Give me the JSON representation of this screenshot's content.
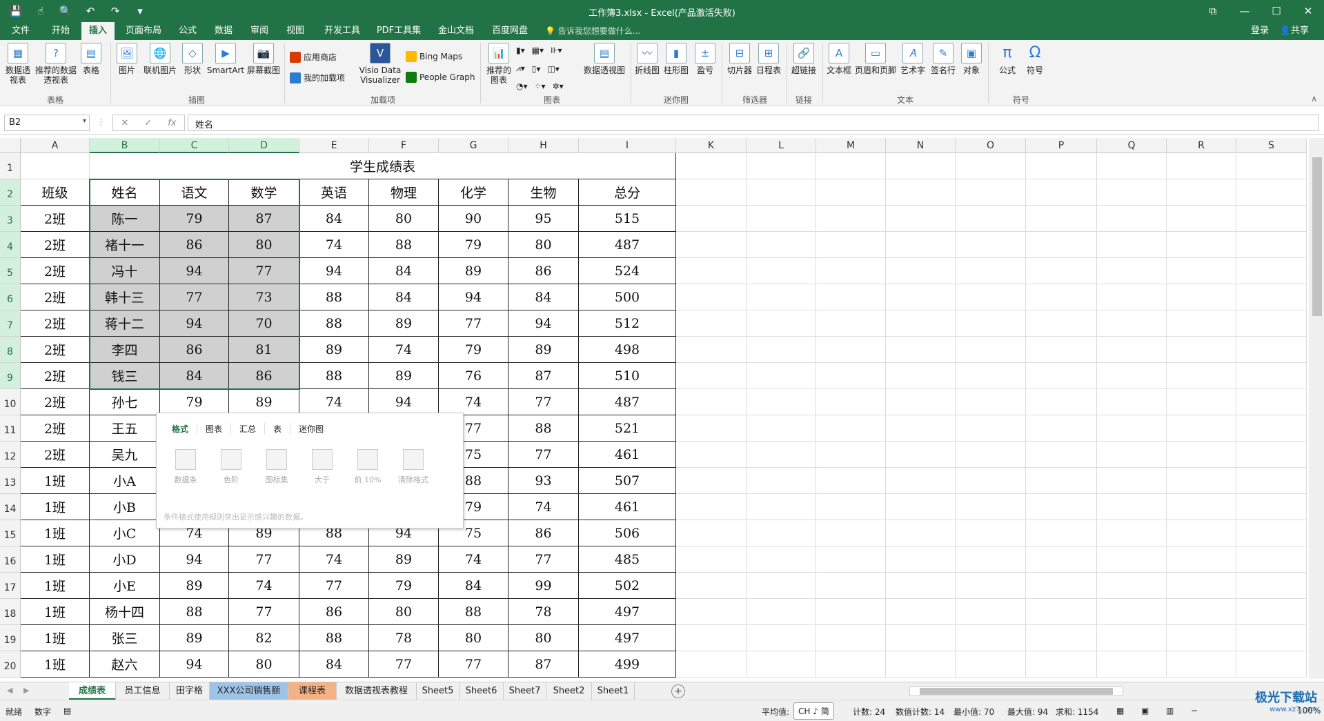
{
  "title_bar": {
    "title": "工作簿3.xlsx - Excel(产品激活失败)",
    "controls": [
      "⧉",
      "—",
      "☐",
      "✕"
    ]
  },
  "quick_access": {
    "icons": [
      "save-icon",
      "touch-icon",
      "preview-icon",
      "undo-icon",
      "redo-icon",
      "customize-icon"
    ]
  },
  "menu_tabs": [
    {
      "label": "文件"
    },
    {
      "label": "开始"
    },
    {
      "label": "插入"
    },
    {
      "label": "页面布局"
    },
    {
      "label": "公式"
    },
    {
      "label": "数据"
    },
    {
      "label": "审阅"
    },
    {
      "label": "视图"
    },
    {
      "label": "开发工具"
    },
    {
      "label": "PDF工具集"
    },
    {
      "label": "金山文档"
    },
    {
      "label": "百度网盘"
    }
  ],
  "active_tab": "插入",
  "tell_me": "告诉我您想要做什么...",
  "account": {
    "login": "登录",
    "share": "共享"
  },
  "ribbon": {
    "tables_group": {
      "label": "表格",
      "buttons": [
        "数据透视表",
        "推荐的数据透视表",
        "表格"
      ]
    },
    "illustrations_group": {
      "label": "插图",
      "buttons": [
        "图片",
        "联机图片",
        "形状",
        "SmartArt",
        "屏幕截图"
      ]
    },
    "addins_group": {
      "label": "加载项",
      "buttons": [
        "应用商店",
        "我的加载项",
        "Visio Data Visualizer",
        "Bing Maps",
        "People Graph"
      ]
    },
    "charts_group": {
      "label": "图表",
      "buttons": [
        "推荐的图表",
        "数据透视图"
      ]
    },
    "sparklines_group": {
      "label": "迷你图",
      "buttons": [
        "折线图",
        "柱形图",
        "盈亏"
      ]
    },
    "filters_group": {
      "label": "筛选器",
      "buttons": [
        "切片器",
        "日程表"
      ]
    },
    "links_group": {
      "label": "链接",
      "buttons": [
        "超链接"
      ]
    },
    "text_group": {
      "label": "文本",
      "buttons": [
        "文本框",
        "页眉和页脚",
        "艺术字",
        "签名行",
        "对象"
      ]
    },
    "symbols_group": {
      "label": "符号",
      "buttons": [
        "公式",
        "符号"
      ]
    }
  },
  "formula_bar": {
    "name_box": "B2",
    "content": "姓名"
  },
  "columns": [
    "A",
    "B",
    "C",
    "D",
    "E",
    "F",
    "G",
    "H",
    "I",
    "K",
    "L",
    "M",
    "N",
    "O",
    "P",
    "Q",
    "R",
    "S"
  ],
  "selected_columns": [
    "B",
    "C",
    "D"
  ],
  "sheet": {
    "title": "学生成绩表",
    "headers": [
      "班级",
      "姓名",
      "语文",
      "数学",
      "英语",
      "物理",
      "化学",
      "生物",
      "总分"
    ],
    "rows": [
      [
        "2班",
        "陈一",
        "79",
        "87",
        "84",
        "80",
        "90",
        "95",
        "515"
      ],
      [
        "2班",
        "褚十一",
        "86",
        "80",
        "74",
        "88",
        "79",
        "80",
        "487"
      ],
      [
        "2班",
        "冯十",
        "94",
        "77",
        "94",
        "84",
        "89",
        "86",
        "524"
      ],
      [
        "2班",
        "韩十三",
        "77",
        "73",
        "88",
        "84",
        "94",
        "84",
        "500"
      ],
      [
        "2班",
        "蒋十二",
        "94",
        "70",
        "88",
        "89",
        "77",
        "94",
        "512"
      ],
      [
        "2班",
        "李四",
        "86",
        "81",
        "89",
        "74",
        "79",
        "89",
        "498"
      ],
      [
        "2班",
        "钱三",
        "84",
        "86",
        "88",
        "89",
        "76",
        "87",
        "510"
      ],
      [
        "2班",
        "孙七",
        "79",
        "89",
        "74",
        "94",
        "74",
        "77",
        "487"
      ],
      [
        "2班",
        "王五",
        "",
        "",
        "",
        "",
        "77",
        "88",
        "521"
      ],
      [
        "2班",
        "吴九",
        "",
        "",
        "",
        "",
        "75",
        "77",
        "461"
      ],
      [
        "1班",
        "小A",
        "",
        "",
        "",
        "",
        "88",
        "93",
        "507"
      ],
      [
        "1班",
        "小B",
        "",
        "",
        "",
        "",
        "79",
        "74",
        "461"
      ],
      [
        "1班",
        "小C",
        "74",
        "89",
        "88",
        "94",
        "75",
        "86",
        "506"
      ],
      [
        "1班",
        "小D",
        "94",
        "77",
        "74",
        "89",
        "74",
        "77",
        "485"
      ],
      [
        "1班",
        "小E",
        "89",
        "74",
        "77",
        "79",
        "84",
        "99",
        "502"
      ],
      [
        "1班",
        "杨十四",
        "88",
        "77",
        "86",
        "80",
        "88",
        "78",
        "497"
      ],
      [
        "1班",
        "张三",
        "89",
        "82",
        "88",
        "78",
        "80",
        "80",
        "497"
      ],
      [
        "1班",
        "赵六",
        "94",
        "80",
        "84",
        "77",
        "77",
        "87",
        "499"
      ]
    ]
  },
  "quick_analysis": {
    "tabs": [
      "格式",
      "图表",
      "汇总",
      "表",
      "迷你图"
    ],
    "options": [
      "数据条",
      "色阶",
      "图标集",
      "大于",
      "前 10%",
      "清除格式"
    ],
    "description": "条件格式使用规则突出显示感兴趣的数据。"
  },
  "sheet_tabs": [
    "成绩表",
    "员工信息",
    "田字格",
    "XXX公司销售额",
    "课程表",
    "数据透视表教程",
    "Sheet5",
    "Sheet6",
    "Sheet7",
    "Sheet2",
    "Sheet1"
  ],
  "status": {
    "mode": "就绪",
    "input": "数字",
    "average": "平均值: ",
    "ime": "CH ♪ 简",
    "count": "计数: 24",
    "numcount": "数值计数: 14",
    "min": "最小值: 70",
    "max": "最大值: 94",
    "sum": "求和: 1154",
    "zoom": "100%"
  },
  "watermark": {
    "text": "极光下载站",
    "url": "www.xz7.com"
  },
  "colors": {
    "accent": "#217346",
    "selection": "#d3f0dc",
    "highlight": "#d0d0d0"
  }
}
